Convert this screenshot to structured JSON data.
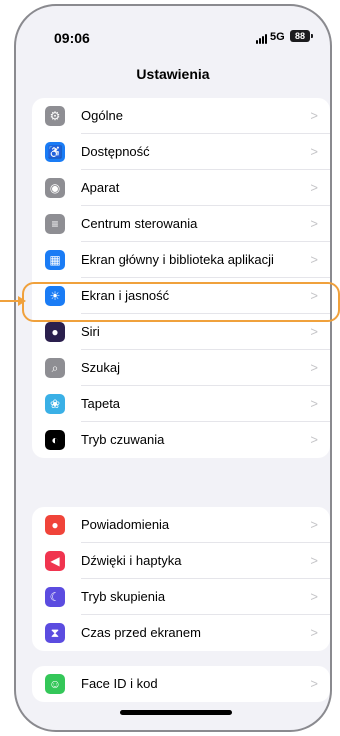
{
  "status": {
    "time": "09:06",
    "network": "5G",
    "battery": "88"
  },
  "title": "Ustawienia",
  "group1": [
    {
      "label": "Ogólne",
      "icon": "gear-icon",
      "color": "#8e8e93",
      "glyph": "⚙"
    },
    {
      "label": "Dostępność",
      "icon": "accessibility-icon",
      "color": "#1a7cf5",
      "glyph": "♿"
    },
    {
      "label": "Aparat",
      "icon": "camera-icon",
      "color": "#8e8e93",
      "glyph": "◉"
    },
    {
      "label": "Centrum sterowania",
      "icon": "control-center-icon",
      "color": "#8e8e93",
      "glyph": "≡"
    },
    {
      "label": "Ekran główny i biblioteka aplikacji",
      "icon": "home-screen-icon",
      "color": "#1a7cf5",
      "glyph": "▦"
    },
    {
      "label": "Ekran i jasność",
      "icon": "brightness-icon",
      "color": "#1a7cf5",
      "glyph": "☀"
    },
    {
      "label": "Siri",
      "icon": "siri-icon",
      "color": "#2a1f4d",
      "glyph": "●"
    },
    {
      "label": "Szukaj",
      "icon": "search-icon",
      "color": "#8e8e93",
      "glyph": "⌕"
    },
    {
      "label": "Tapeta",
      "icon": "wallpaper-icon",
      "color": "#3ab0e6",
      "glyph": "❀"
    },
    {
      "label": "Tryb czuwania",
      "icon": "standby-icon",
      "color": "#000000",
      "glyph": "◐"
    }
  ],
  "group2": [
    {
      "label": "Powiadomienia",
      "icon": "notifications-icon",
      "color": "#f0443a",
      "glyph": "●"
    },
    {
      "label": "Dźwięki i haptyka",
      "icon": "sound-icon",
      "color": "#f0344f",
      "glyph": "◀"
    },
    {
      "label": "Tryb skupienia",
      "icon": "focus-moon-icon",
      "color": "#5b4ce0",
      "glyph": "☾"
    },
    {
      "label": "Czas przed ekranem",
      "icon": "screen-time-icon",
      "color": "#5b4ce0",
      "glyph": "⧗"
    }
  ],
  "group3": [
    {
      "label": "Face ID i kod",
      "icon": "face-id-icon",
      "color": "#34c759",
      "glyph": "☺"
    }
  ],
  "chevron": ">",
  "colors": {
    "highlight": "#f0a13c",
    "background": "#f2f2f7"
  }
}
